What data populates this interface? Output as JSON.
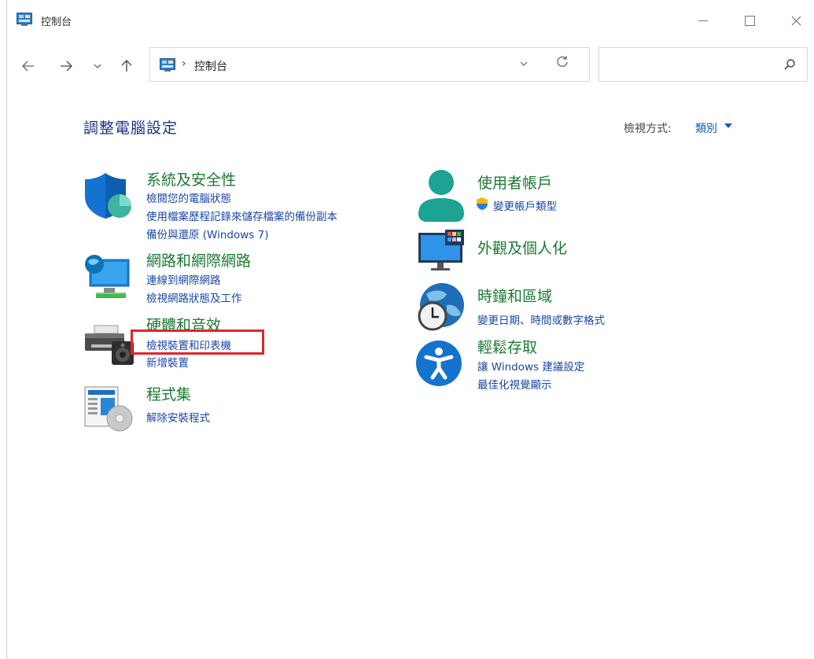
{
  "window": {
    "title": "控制台"
  },
  "address": {
    "separator": "›",
    "path": "控制台"
  },
  "header": {
    "title": "調整電腦設定",
    "view_by_label": "檢視方式:",
    "view_by_value": "類別"
  },
  "categories": {
    "system": {
      "title": "系統及安全性",
      "links": [
        "檢閱您的電腦狀態",
        "使用檔案歷程記錄來儲存檔案的備份副本",
        "備份與還原 (Windows 7)"
      ]
    },
    "network": {
      "title": "網路和網際網路",
      "links": [
        "連線到網際網路",
        "檢視網路狀態及工作"
      ]
    },
    "hardware": {
      "title": "硬體和音效",
      "links": [
        "檢視裝置和印表機",
        "新增裝置"
      ]
    },
    "programs": {
      "title": "程式集",
      "links": [
        "解除安裝程式"
      ]
    },
    "users": {
      "title": "使用者帳戶",
      "links": [
        "變更帳戶類型"
      ]
    },
    "appearance": {
      "title": "外觀及個人化",
      "links": []
    },
    "clock": {
      "title": "時鐘和區域",
      "links": [
        "變更日期、時間或數字格式"
      ]
    },
    "ease": {
      "title": "輕鬆存取",
      "links": [
        "讓 Windows 建議設定",
        "最佳化視覺顯示"
      ]
    }
  }
}
